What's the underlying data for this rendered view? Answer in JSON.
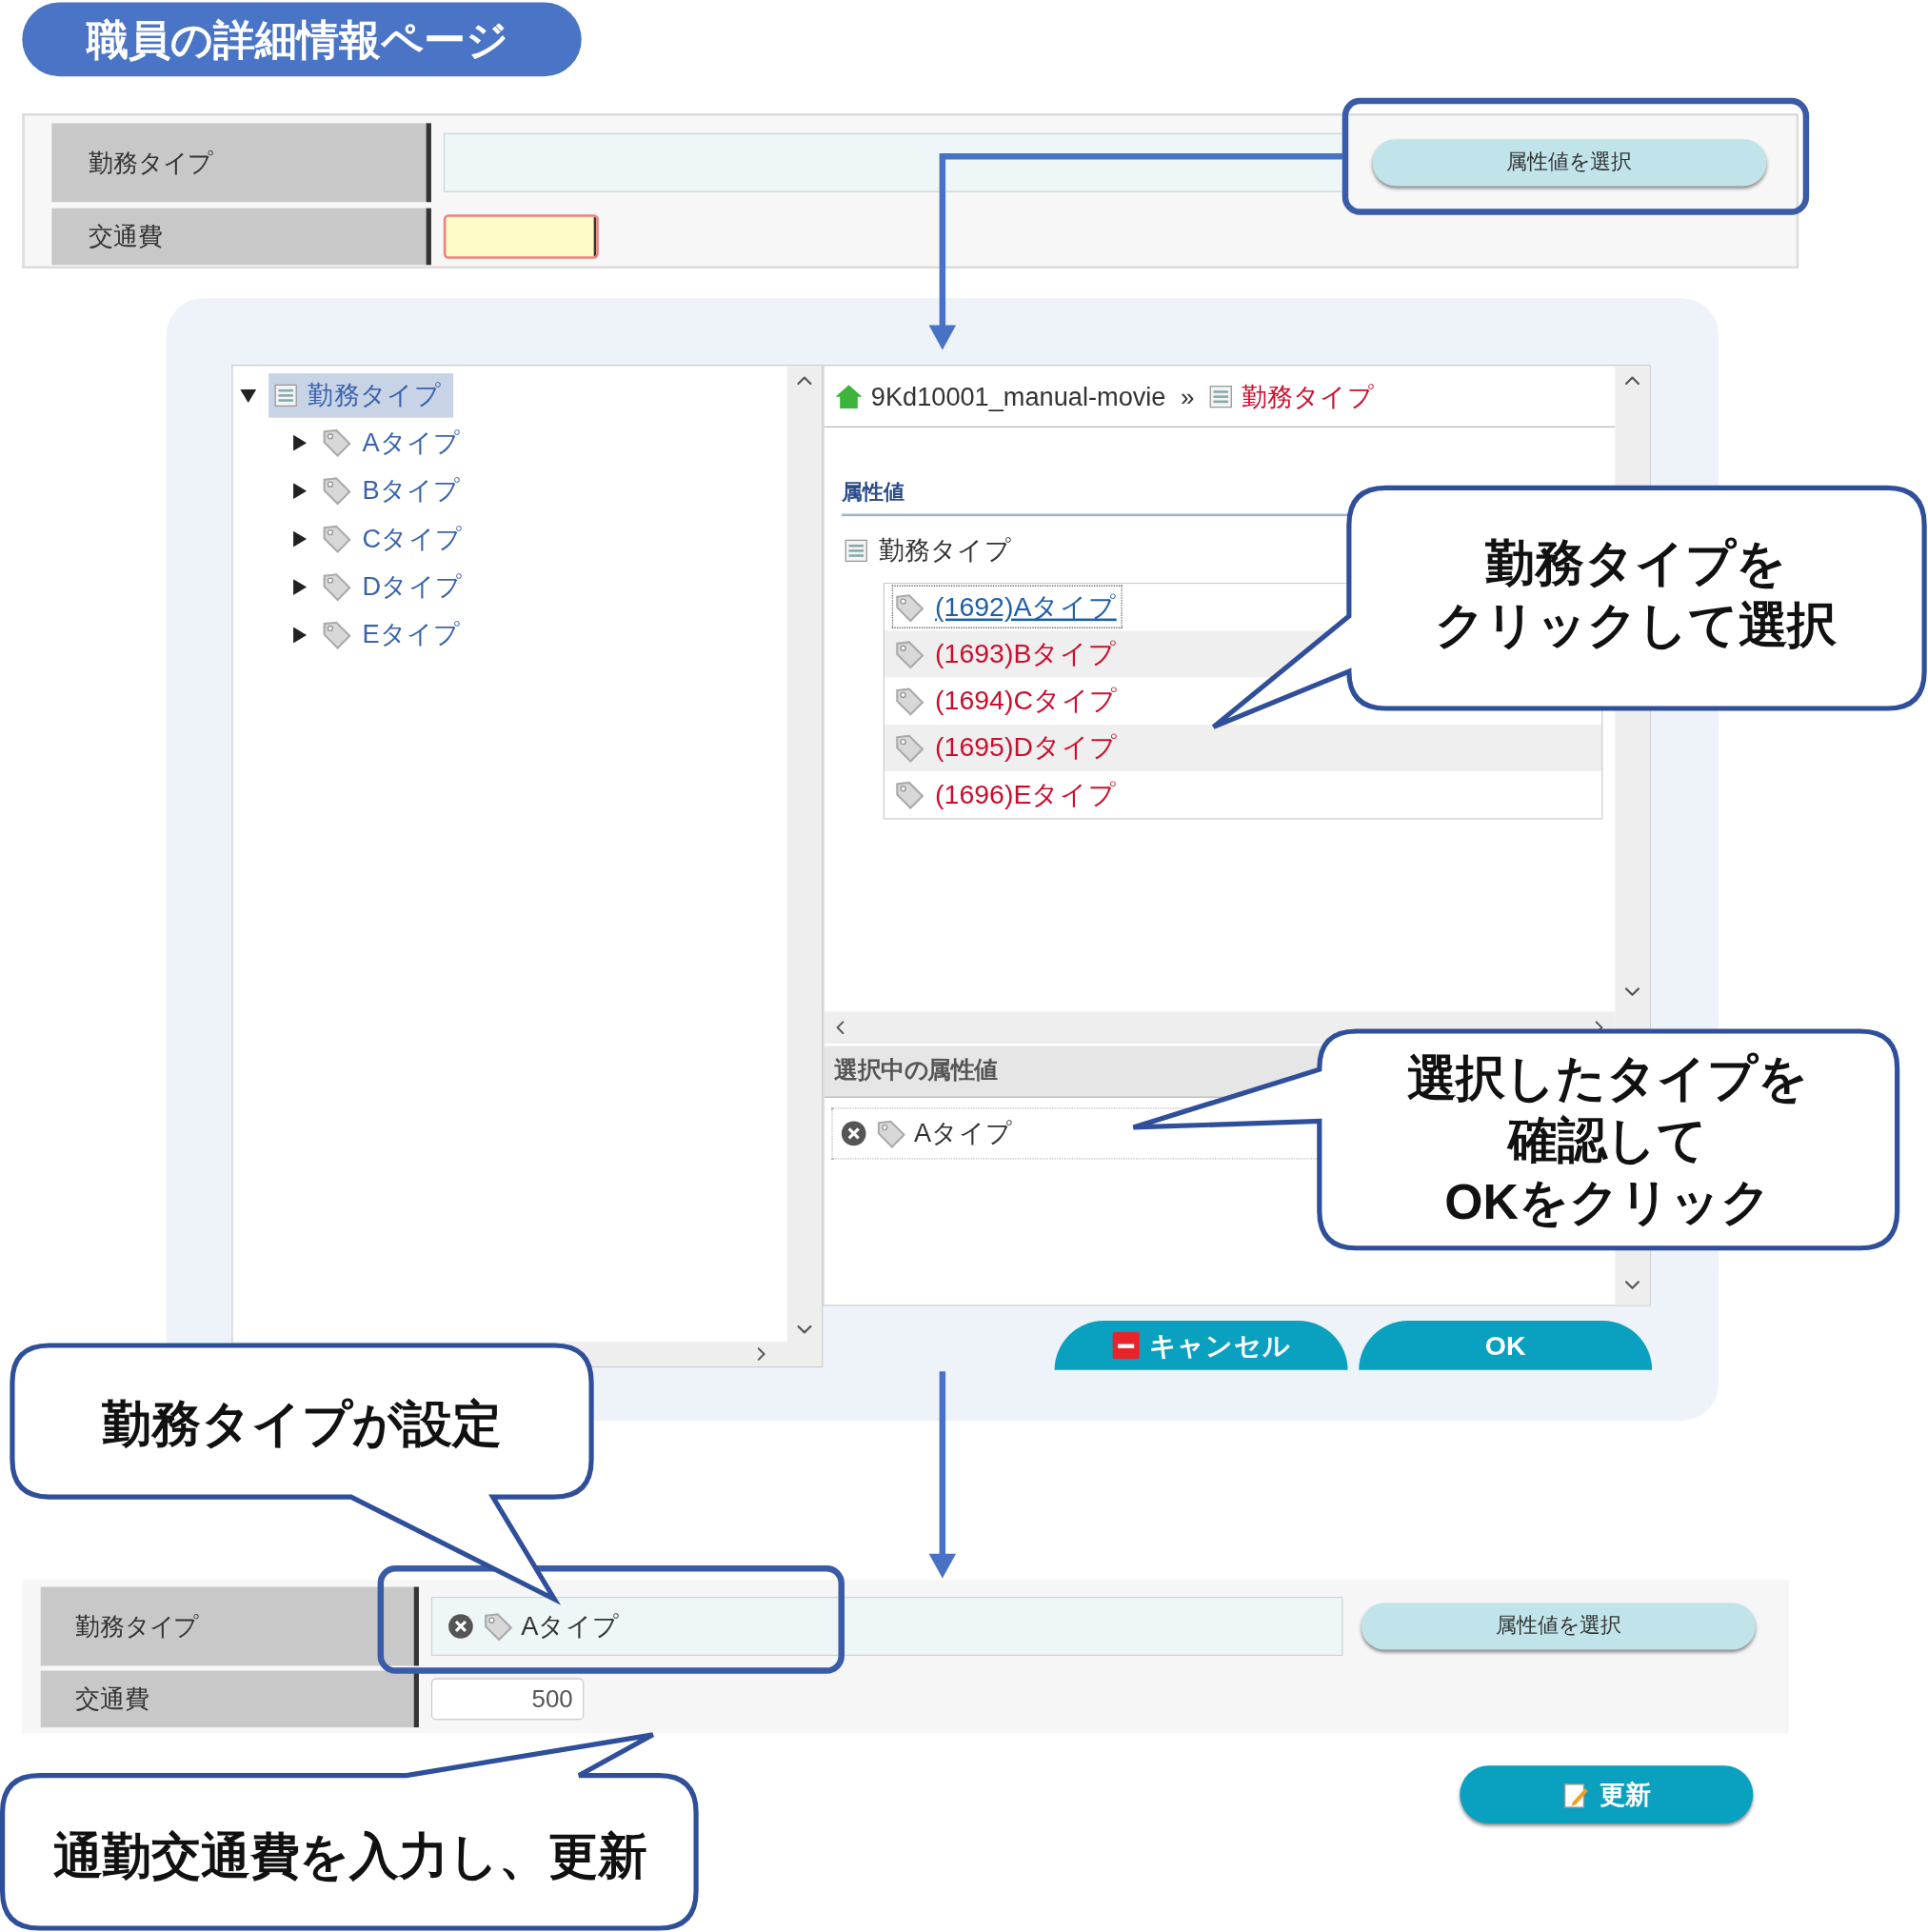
{
  "title": "職員の詳細情報ページ",
  "form_before": {
    "rows": [
      {
        "label": "勤務タイプ",
        "kind": "attribute"
      },
      {
        "label": "交通費",
        "kind": "input",
        "focused": true
      }
    ],
    "button": "属性値を選択"
  },
  "dialog": {
    "tree": [
      {
        "label": "勤務タイプ",
        "selected": true,
        "expanded": true,
        "children": [
          {
            "label": "Aタイプ",
            "selected": false,
            "expanded": false
          },
          {
            "label": "Bタイプ",
            "selected": false,
            "expanded": false
          },
          {
            "label": "Cタイプ",
            "selected": false,
            "expanded": false
          },
          {
            "label": "Dタイプ",
            "selected": false,
            "expanded": false
          },
          {
            "label": "Eタイプ",
            "selected": false,
            "expanded": false
          }
        ]
      }
    ],
    "breadcrumb": {
      "items": [
        "9Kd10001_manual-movie",
        "勤務タイプ"
      ],
      "separator": "»"
    },
    "section_title": "属性値",
    "group": "勤務タイプ",
    "values": [
      {
        "label": "(1692)Aタイプ",
        "selected": true
      },
      {
        "label": "(1693)Bタイプ",
        "selected": false
      },
      {
        "label": "(1694)Cタイプ",
        "selected": false
      },
      {
        "label": "(1695)Dタイプ",
        "selected": false
      },
      {
        "label": "(1696)Eタイプ",
        "selected": false
      }
    ],
    "selected_title": "選択中の属性値",
    "selected_items": [
      "Aタイプ"
    ],
    "cancel_button": "キャンセル",
    "ok_button": "OK"
  },
  "form_after": {
    "rows": [
      {
        "label": "勤務タイプ",
        "kind": "attribute",
        "chip": "Aタイプ"
      },
      {
        "label": "交通費",
        "kind": "input",
        "value": "500",
        "focused": false
      }
    ],
    "button": "属性値を選択",
    "update_button": "更新"
  },
  "callouts": [
    {
      "lines": [
        "勤務タイプを",
        "クリックして選択"
      ]
    },
    {
      "lines": [
        "選択したタイプを",
        "確認して",
        "OKをクリック"
      ]
    },
    {
      "lines": [
        "勤務タイプが設定"
      ]
    },
    {
      "lines": [
        "通勤交通費を入力し、更新"
      ]
    }
  ]
}
